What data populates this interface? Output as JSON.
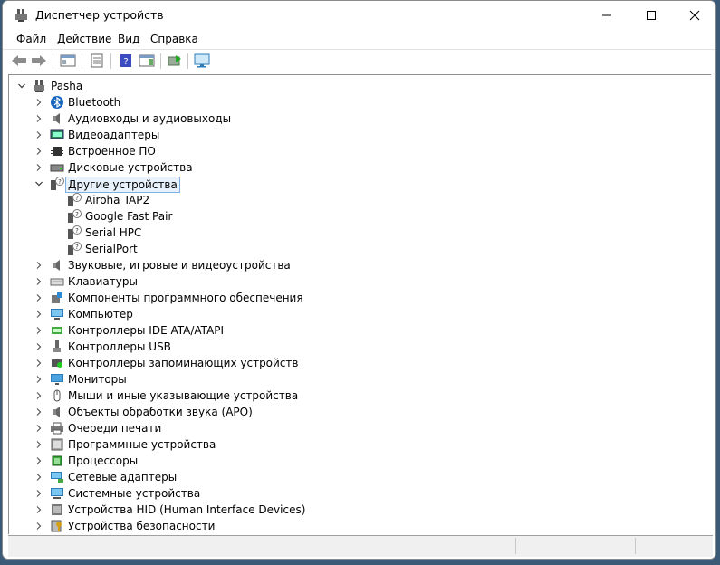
{
  "window": {
    "title": "Диспетчер устройств"
  },
  "menu": [
    "Файл",
    "Действие",
    "Вид",
    "Справка"
  ],
  "tree": {
    "root": "Pasha",
    "categories": [
      {
        "label": "Bluetooth",
        "icon": "bluetooth-icon",
        "expanded": false
      },
      {
        "label": "Аудиовходы и аудиовыходы",
        "icon": "speaker-icon",
        "expanded": false
      },
      {
        "label": "Видеоадаптеры",
        "icon": "display-adapter-icon",
        "expanded": false
      },
      {
        "label": "Встроенное ПО",
        "icon": "chip-icon",
        "expanded": false
      },
      {
        "label": "Дисковые устройства",
        "icon": "disk-drive-icon",
        "expanded": false
      },
      {
        "label": "Другие устройства",
        "icon": "unknown-device-icon",
        "expanded": true,
        "children": [
          "Airoha_IAP2",
          "Google Fast Pair",
          "Serial HPC",
          "SerialPort"
        ]
      },
      {
        "label": "Звуковые, игровые и видеоустройства",
        "icon": "speaker-icon",
        "expanded": false
      },
      {
        "label": "Клавиатуры",
        "icon": "keyboard-icon",
        "expanded": false
      },
      {
        "label": "Компоненты программного обеспечения",
        "icon": "software-component-icon",
        "expanded": false
      },
      {
        "label": "Компьютер",
        "icon": "computer-icon",
        "expanded": false
      },
      {
        "label": "Контроллеры IDE ATA/ATAPI",
        "icon": "ide-controller-icon",
        "expanded": false
      },
      {
        "label": "Контроллеры USB",
        "icon": "usb-icon",
        "expanded": false
      },
      {
        "label": "Контроллеры запоминающих устройств",
        "icon": "storage-controller-icon",
        "expanded": false
      },
      {
        "label": "Мониторы",
        "icon": "monitor-icon",
        "expanded": false
      },
      {
        "label": "Мыши и иные указывающие устройства",
        "icon": "mouse-icon",
        "expanded": false
      },
      {
        "label": "Объекты обработки звука (APO)",
        "icon": "speaker-icon",
        "expanded": false
      },
      {
        "label": "Очереди печати",
        "icon": "printer-icon",
        "expanded": false
      },
      {
        "label": "Программные устройства",
        "icon": "software-device-icon",
        "expanded": false
      },
      {
        "label": "Процессоры",
        "icon": "processor-icon",
        "expanded": false
      },
      {
        "label": "Сетевые адаптеры",
        "icon": "network-adapter-icon",
        "expanded": false
      },
      {
        "label": "Системные устройства",
        "icon": "system-device-icon",
        "expanded": false
      },
      {
        "label": "Устройства HID (Human Interface Devices)",
        "icon": "hid-icon",
        "expanded": false
      },
      {
        "label": "Устройства безопасности",
        "icon": "security-device-icon",
        "expanded": false
      }
    ]
  },
  "selected": "Другие устройства"
}
